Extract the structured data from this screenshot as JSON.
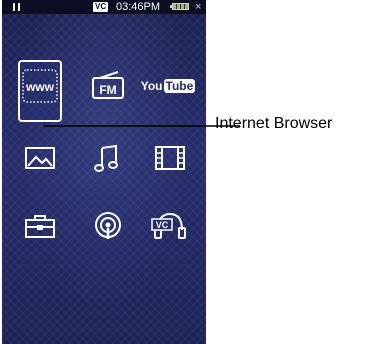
{
  "status_bar": {
    "vc_badge": "VC",
    "time": "03:46PM",
    "close_glyph": "×"
  },
  "home_menu": {
    "selected": "internet-browser",
    "icons": [
      {
        "id": "internet-browser",
        "icon": "www-globe-icon",
        "text": "www"
      },
      {
        "id": "fm-radio",
        "icon": "fm-radio-icon",
        "text": "FM"
      },
      {
        "id": "youtube",
        "icon": "youtube-icon",
        "text_you": "You",
        "text_tube": "Tube"
      },
      {
        "id": "photo",
        "icon": "photo-icon"
      },
      {
        "id": "music",
        "icon": "music-note-icon"
      },
      {
        "id": "video",
        "icon": "film-strip-icon"
      },
      {
        "id": "settings",
        "icon": "toolbox-icon"
      },
      {
        "id": "podcast",
        "icon": "podcast-icon"
      },
      {
        "id": "voice-capture",
        "icon": "vc-headphone-icon",
        "text": "VC"
      }
    ]
  },
  "callout": {
    "label": "Internet Browser"
  },
  "colors": {
    "screen_background": "#262c6c",
    "icon": "#ffffff",
    "callout_text": "#000000"
  }
}
